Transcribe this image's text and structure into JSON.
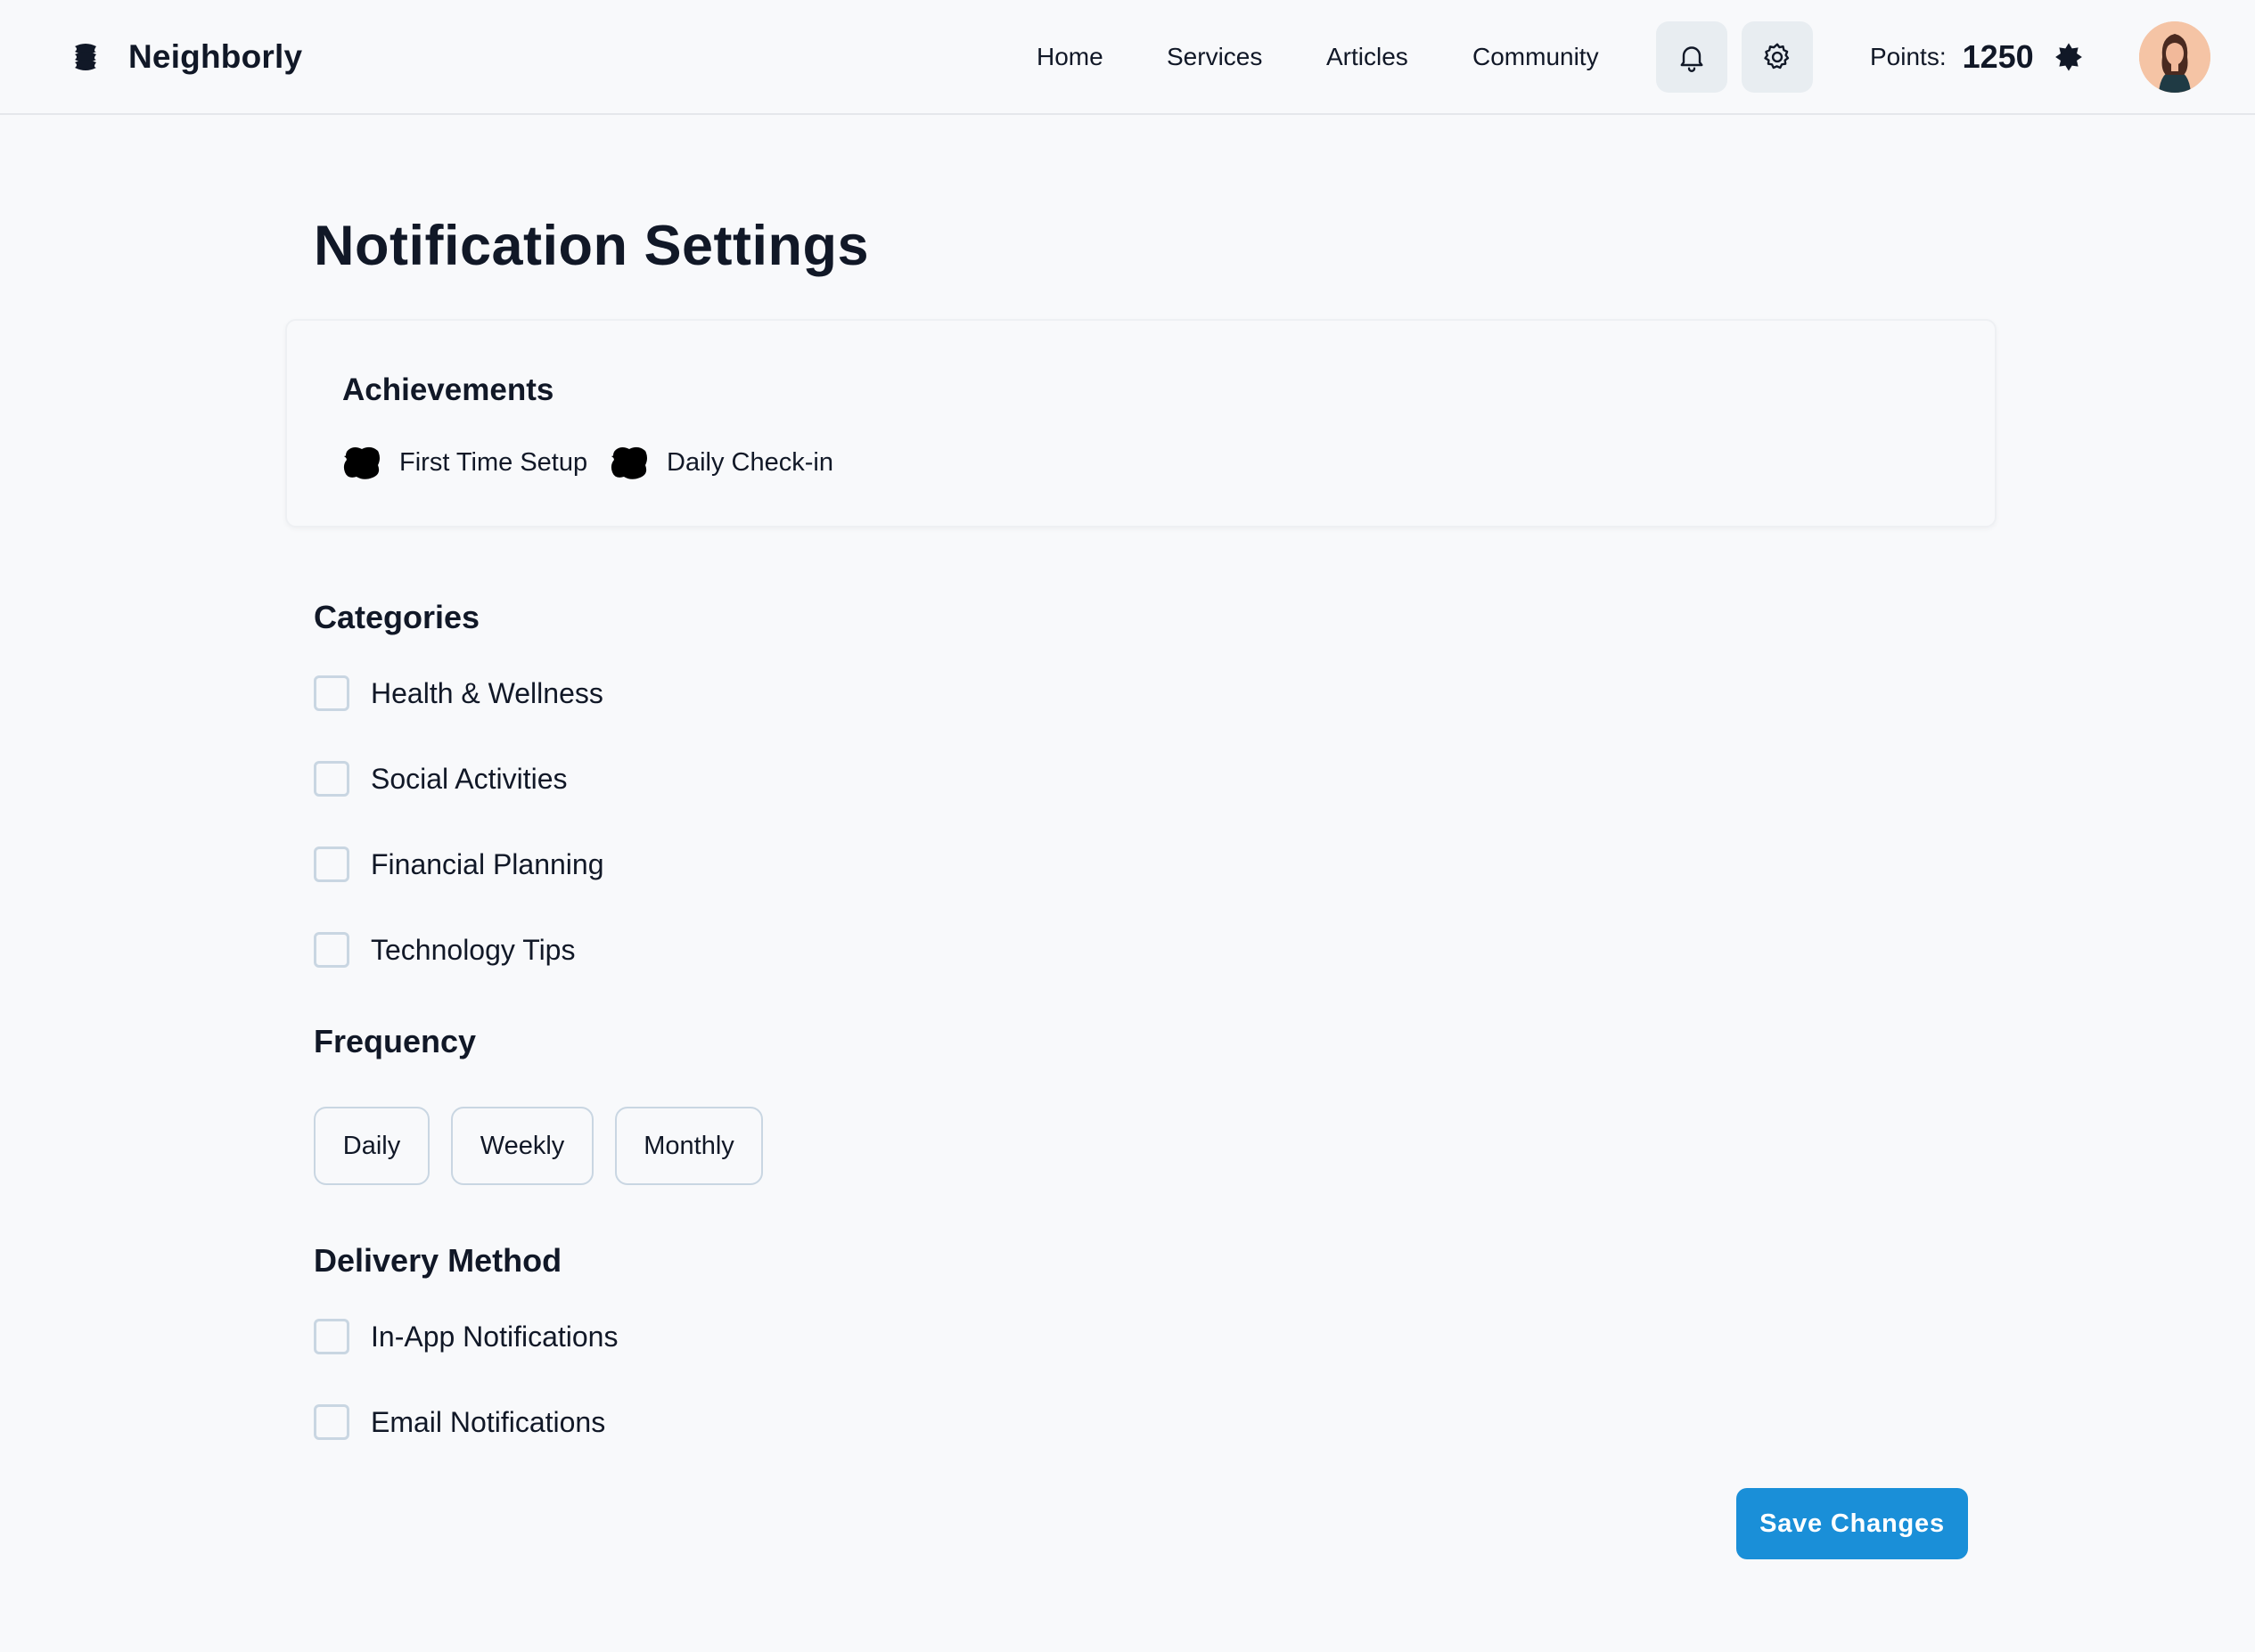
{
  "header": {
    "brand": "Neighborly",
    "nav": [
      {
        "label": "Home"
      },
      {
        "label": "Services"
      },
      {
        "label": "Articles"
      },
      {
        "label": "Community"
      }
    ],
    "icons": [
      "bell-icon",
      "gear-icon",
      "badge-icon"
    ],
    "points_label": "Points:",
    "points_value": "1250"
  },
  "page": {
    "title": "Notification Settings"
  },
  "achievements": {
    "title": "Achievements",
    "items": [
      {
        "label": "First Time Setup",
        "icon": "achievement-icon"
      },
      {
        "label": "Daily Check-in",
        "icon": "achievement-icon"
      }
    ]
  },
  "categories": {
    "title": "Categories",
    "items": [
      {
        "label": "Health & Wellness",
        "checked": false
      },
      {
        "label": "Social Activities",
        "checked": false
      },
      {
        "label": "Financial Planning",
        "checked": false
      },
      {
        "label": "Technology Tips",
        "checked": false
      }
    ]
  },
  "frequency": {
    "title": "Frequency",
    "options": [
      {
        "label": "Daily"
      },
      {
        "label": "Weekly"
      },
      {
        "label": "Monthly"
      }
    ]
  },
  "delivery": {
    "title": "Delivery Method",
    "items": [
      {
        "label": "In-App Notifications",
        "checked": false
      },
      {
        "label": "Email Notifications",
        "checked": false
      }
    ]
  },
  "actions": {
    "save_label": "Save Changes"
  },
  "colors": {
    "accent": "#1a8fd8",
    "background": "#f8f9fb",
    "icon_button_bg": "#e8edf1",
    "checkbox_border": "#c9d6e2"
  }
}
